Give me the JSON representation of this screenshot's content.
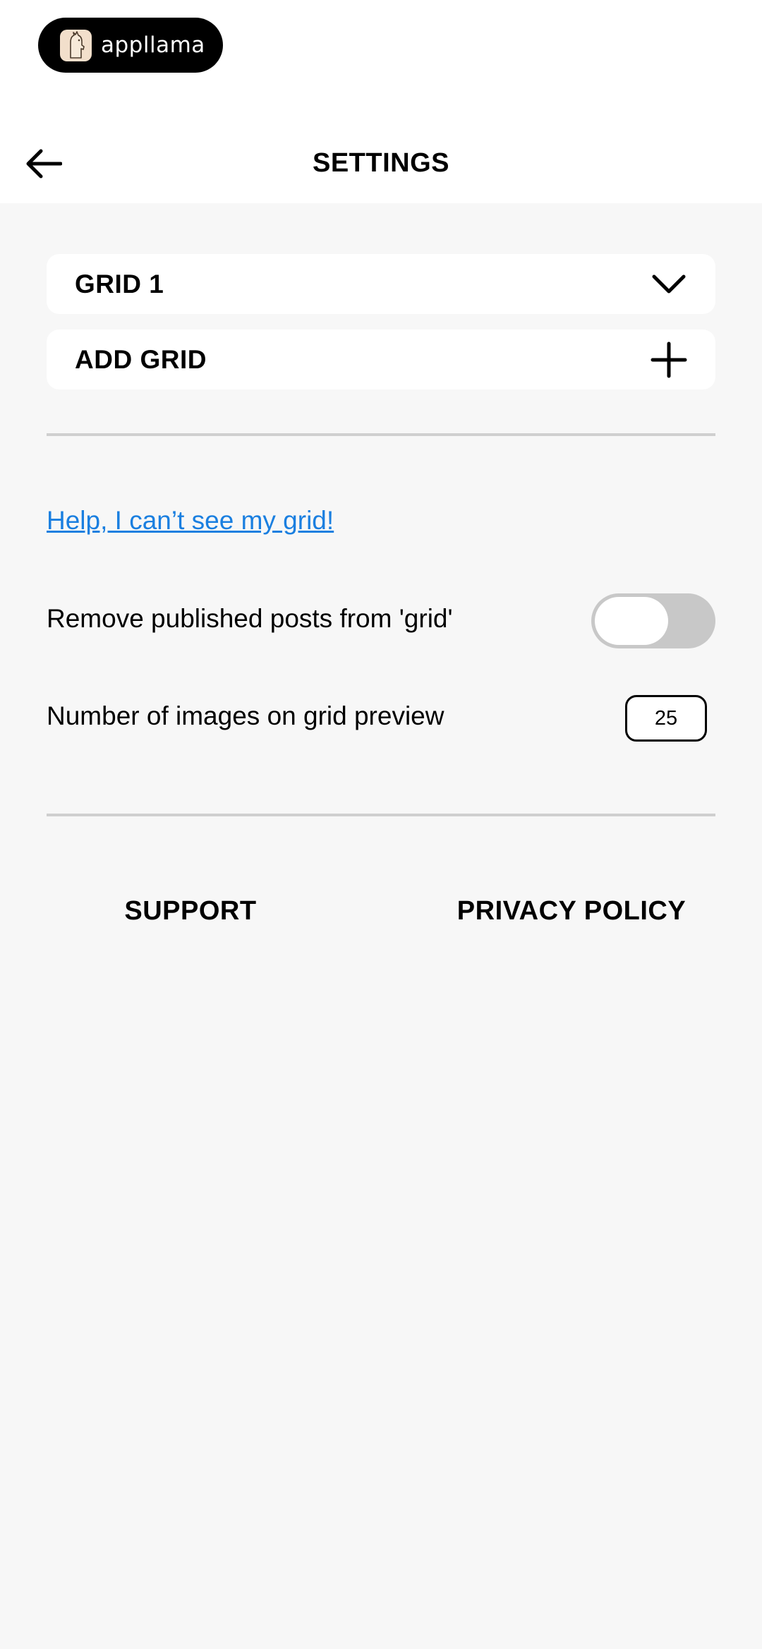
{
  "brand": {
    "name": "appllama",
    "logo_icon": "llama-icon"
  },
  "header": {
    "title": "SETTINGS",
    "back_icon": "arrow-left-icon"
  },
  "grids": {
    "current_label": "GRID 1",
    "current_icon": "chevron-down-icon",
    "add_label": "ADD GRID",
    "add_icon": "plus-icon"
  },
  "help": {
    "link_text": "Help, I can’t see my grid!",
    "link_color": "#1a7fe0"
  },
  "settings": {
    "remove_published": {
      "label": "Remove published posts from 'grid'",
      "enabled": false
    },
    "image_count": {
      "label": "Number of images on grid preview",
      "value": "25"
    }
  },
  "footer": {
    "support_label": "SUPPORT",
    "privacy_label": "PRIVACY POLICY"
  },
  "colors": {
    "background": "#f7f7f7",
    "card": "#ffffff",
    "toggle_off": "#c8c8c8",
    "divider": "#cfcfcf"
  }
}
